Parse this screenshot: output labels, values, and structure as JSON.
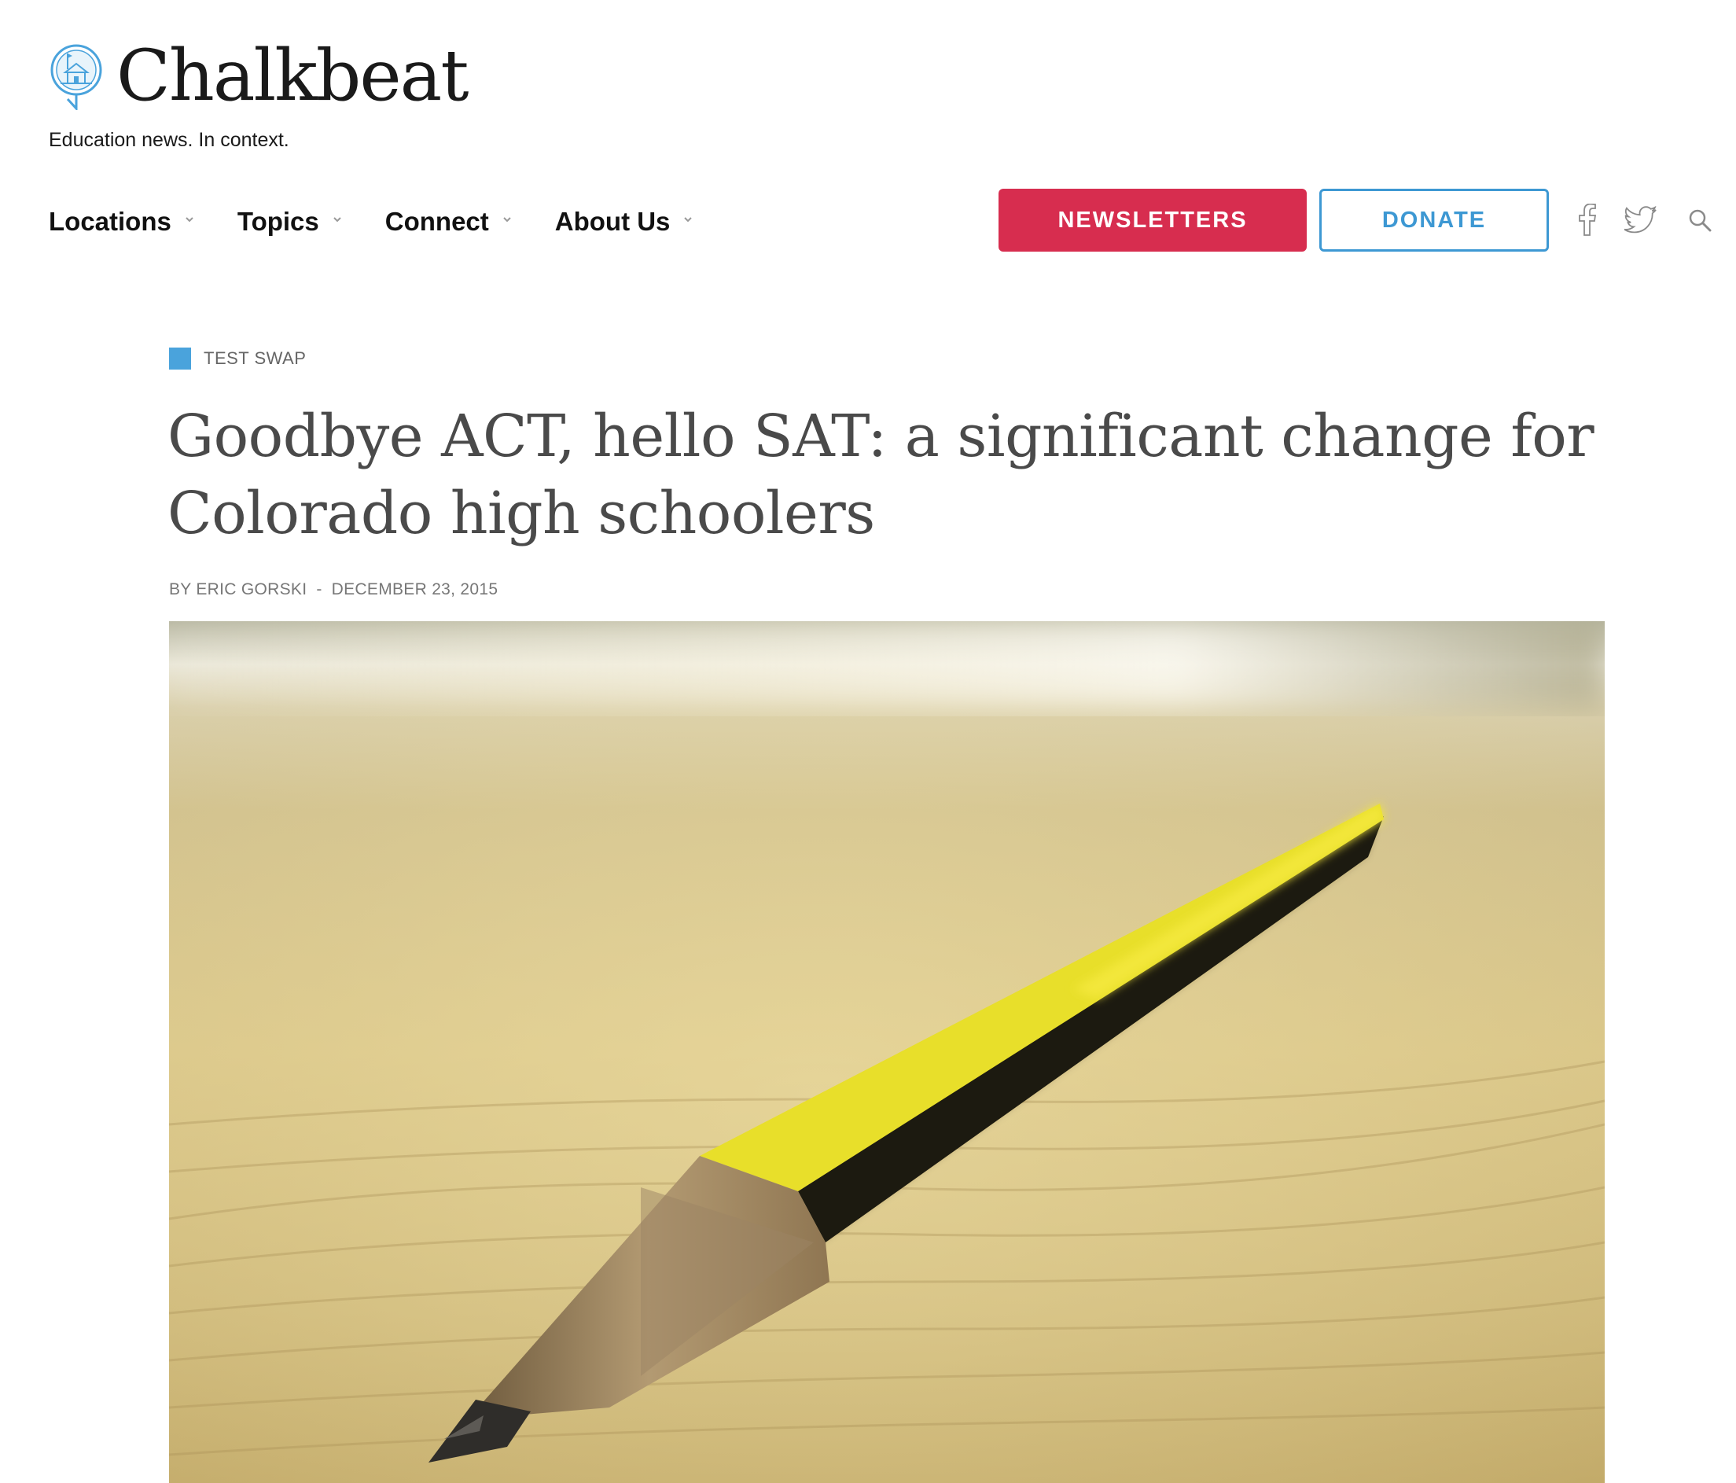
{
  "brand": {
    "name": "Chalkbeat",
    "tagline": "Education news. In context.",
    "logo_icon": "schoolhouse-pin-icon",
    "accent_color": "#4aa3dc"
  },
  "nav": {
    "items": [
      {
        "label": "Locations"
      },
      {
        "label": "Topics"
      },
      {
        "label": "Connect"
      },
      {
        "label": "About Us"
      }
    ]
  },
  "actions": {
    "newsletters_label": "NEWSLETTERS",
    "newsletters_color": "#d72d4f",
    "donate_label": "DONATE",
    "donate_color": "#3d98d3"
  },
  "social": {
    "facebook_icon": "facebook-icon",
    "twitter_icon": "twitter-icon",
    "search_icon": "search-icon"
  },
  "article": {
    "category": "TEST SWAP",
    "headline": "Goodbye ACT, hello SAT: a significant change for Colorado high schoolers",
    "author": "BY ERIC GORSKI",
    "separator": "-",
    "date": "DECEMBER 23, 2015",
    "hero_image": "yellow-black-pencil-on-wooden-desk"
  }
}
